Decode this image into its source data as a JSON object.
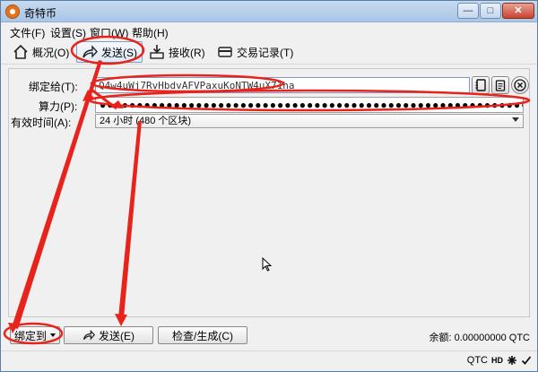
{
  "window": {
    "title": "奇特币"
  },
  "window_controls": {
    "minimize": "—",
    "maximize": "□",
    "close": "✕"
  },
  "menu": [
    {
      "label": "文件(F)"
    },
    {
      "label": "设置(S)"
    },
    {
      "label": "窗口(W)"
    },
    {
      "label": "帮助(H)"
    }
  ],
  "toolbar": {
    "overview": "概况(O)",
    "send": "发送(S)",
    "receive": "接收(R)",
    "transactions": "交易记录(T)"
  },
  "form": {
    "bind_label": "绑定给(T):",
    "bind_value": "Q4w4uWj7RvHbdvAFVPaxuKoNTW4uX71ha",
    "power_label": "算力(P):",
    "power_value": "●●●●●●●●●●●●●●●●●●●●●●●●●●●●●●●●●●●●●●●●●●●●●●●●●●●●●●●●●●●●●●●●",
    "validity_label": "有效时间(A):",
    "validity_value": "24 小时 (480 个区块)"
  },
  "bottom": {
    "bind_to": "绑定到",
    "send": "发送(E)",
    "check": "检查/生成(C)",
    "balance": "余额: 0.00000000 QTC"
  },
  "status": {
    "unit": "QTC",
    "hd": "HD"
  },
  "colors": {
    "annotation": "#e8231b",
    "accent": "#7aa0c8"
  }
}
